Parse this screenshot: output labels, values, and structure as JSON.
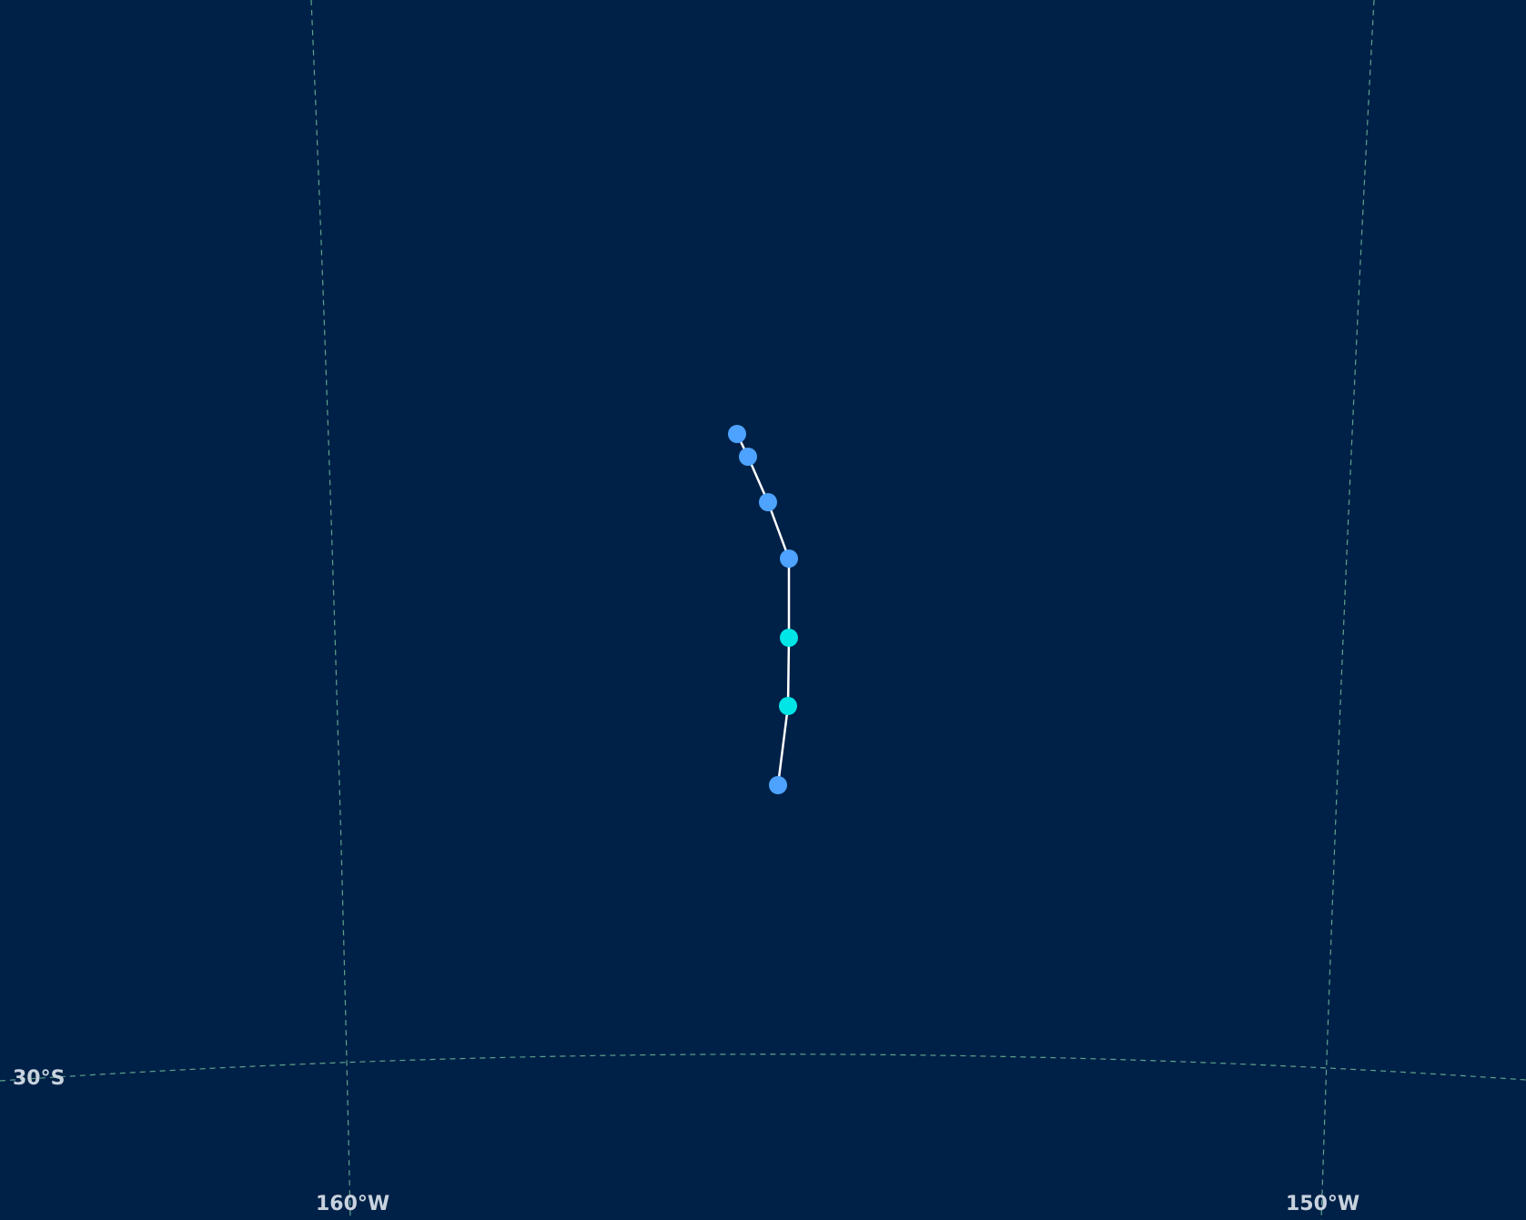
{
  "map": {
    "background_color": "#002147",
    "graticule_color": "#6fb89a",
    "track_line_color": "#ffffff",
    "graticule_labels": {
      "lat_30s": "30°S",
      "lon_160w": "160°W",
      "lon_150w": "150°W"
    },
    "track_points": [
      {
        "index": 1,
        "color": "#4da3ff"
      },
      {
        "index": 2,
        "color": "#4da3ff"
      },
      {
        "index": 3,
        "color": "#4da3ff"
      },
      {
        "index": 4,
        "color": "#4da3ff"
      },
      {
        "index": 5,
        "color": "#00e5e5"
      },
      {
        "index": 6,
        "color": "#00e5e5"
      },
      {
        "index": 7,
        "color": "#4da3ff"
      }
    ]
  }
}
